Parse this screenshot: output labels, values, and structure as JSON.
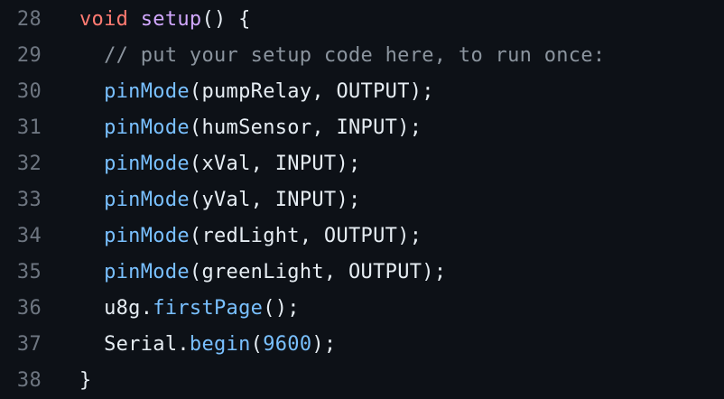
{
  "colors": {
    "background": "#0d1117",
    "line_number": "#6e7681",
    "plain": "#e6edf3",
    "keyword": "#ff7b72",
    "function_name": "#d2a8ff",
    "function_call": "#79c0ff",
    "number": "#79c0ff",
    "comment": "#8b949e"
  },
  "lines": [
    {
      "number": "28",
      "tokens": [
        {
          "text": "void",
          "type": "keyword"
        },
        {
          "text": " ",
          "type": "plain"
        },
        {
          "text": "setup",
          "type": "func"
        },
        {
          "text": "() {",
          "type": "plain"
        }
      ]
    },
    {
      "number": "29",
      "tokens": [
        {
          "text": "  // put your setup code here, to run once:",
          "type": "comment"
        }
      ]
    },
    {
      "number": "30",
      "tokens": [
        {
          "text": "  ",
          "type": "plain"
        },
        {
          "text": "pinMode",
          "type": "call"
        },
        {
          "text": "(pumpRelay, OUTPUT);",
          "type": "plain"
        }
      ]
    },
    {
      "number": "31",
      "tokens": [
        {
          "text": "  ",
          "type": "plain"
        },
        {
          "text": "pinMode",
          "type": "call"
        },
        {
          "text": "(humSensor, INPUT);",
          "type": "plain"
        }
      ]
    },
    {
      "number": "32",
      "tokens": [
        {
          "text": "  ",
          "type": "plain"
        },
        {
          "text": "pinMode",
          "type": "call"
        },
        {
          "text": "(xVal, INPUT);",
          "type": "plain"
        }
      ]
    },
    {
      "number": "33",
      "tokens": [
        {
          "text": "  ",
          "type": "plain"
        },
        {
          "text": "pinMode",
          "type": "call"
        },
        {
          "text": "(yVal, INPUT);",
          "type": "plain"
        }
      ]
    },
    {
      "number": "34",
      "tokens": [
        {
          "text": "  ",
          "type": "plain"
        },
        {
          "text": "pinMode",
          "type": "call"
        },
        {
          "text": "(redLight, OUTPUT);",
          "type": "plain"
        }
      ]
    },
    {
      "number": "35",
      "tokens": [
        {
          "text": "  ",
          "type": "plain"
        },
        {
          "text": "pinMode",
          "type": "call"
        },
        {
          "text": "(greenLight, OUTPUT);",
          "type": "plain"
        }
      ]
    },
    {
      "number": "36",
      "tokens": [
        {
          "text": "  u8g.",
          "type": "plain"
        },
        {
          "text": "firstPage",
          "type": "call"
        },
        {
          "text": "();",
          "type": "plain"
        }
      ]
    },
    {
      "number": "37",
      "tokens": [
        {
          "text": "  Serial.",
          "type": "plain"
        },
        {
          "text": "begin",
          "type": "call"
        },
        {
          "text": "(",
          "type": "plain"
        },
        {
          "text": "9600",
          "type": "const"
        },
        {
          "text": ");",
          "type": "plain"
        }
      ]
    },
    {
      "number": "38",
      "tokens": [
        {
          "text": "}",
          "type": "plain"
        }
      ]
    }
  ]
}
